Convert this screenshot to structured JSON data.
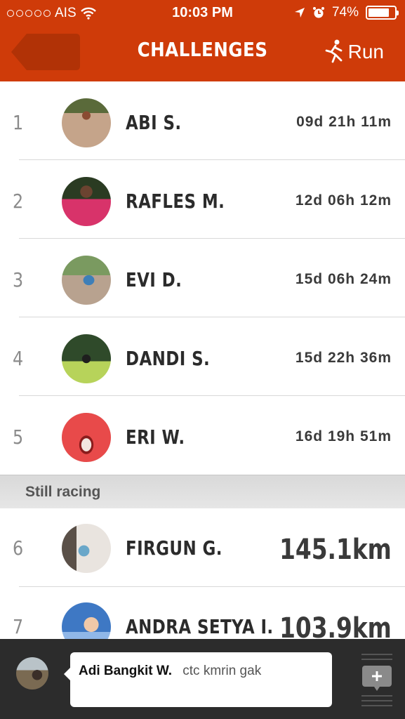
{
  "status_bar": {
    "carrier": "AIS",
    "time": "10:03 PM",
    "battery": "74%",
    "battery_level": 0.74
  },
  "header": {
    "title": "CHALLENGES",
    "run_label": "Run",
    "back_icon": "back-arrow-icon",
    "run_icon": "runner-icon"
  },
  "colors": {
    "header_bg": "#cf3b09",
    "text_dark": "#2b2b2b",
    "rank_gray": "#8b8b8b"
  },
  "finished": [
    {
      "rank": "1",
      "name": "ABI S.",
      "value": "09d 21h 11m"
    },
    {
      "rank": "2",
      "name": "RAFLES M.",
      "value": "12d 06h 12m"
    },
    {
      "rank": "3",
      "name": "EVI D.",
      "value": "15d 06h 24m"
    },
    {
      "rank": "4",
      "name": "DANDI S.",
      "value": "15d 22h 36m"
    },
    {
      "rank": "5",
      "name": "ERI W.",
      "value": "16d 19h 51m"
    }
  ],
  "section_label": "Still racing",
  "racing": [
    {
      "rank": "6",
      "name": "FIRGUN G.",
      "value": "145.1km"
    },
    {
      "rank": "7",
      "name": "ANDRA SETYA I.",
      "value": "103.9km"
    }
  ],
  "chat": {
    "sender": "Adi Bangkit W.",
    "message": "ctc kmrin gak",
    "add_icon": "add-comment-icon"
  }
}
